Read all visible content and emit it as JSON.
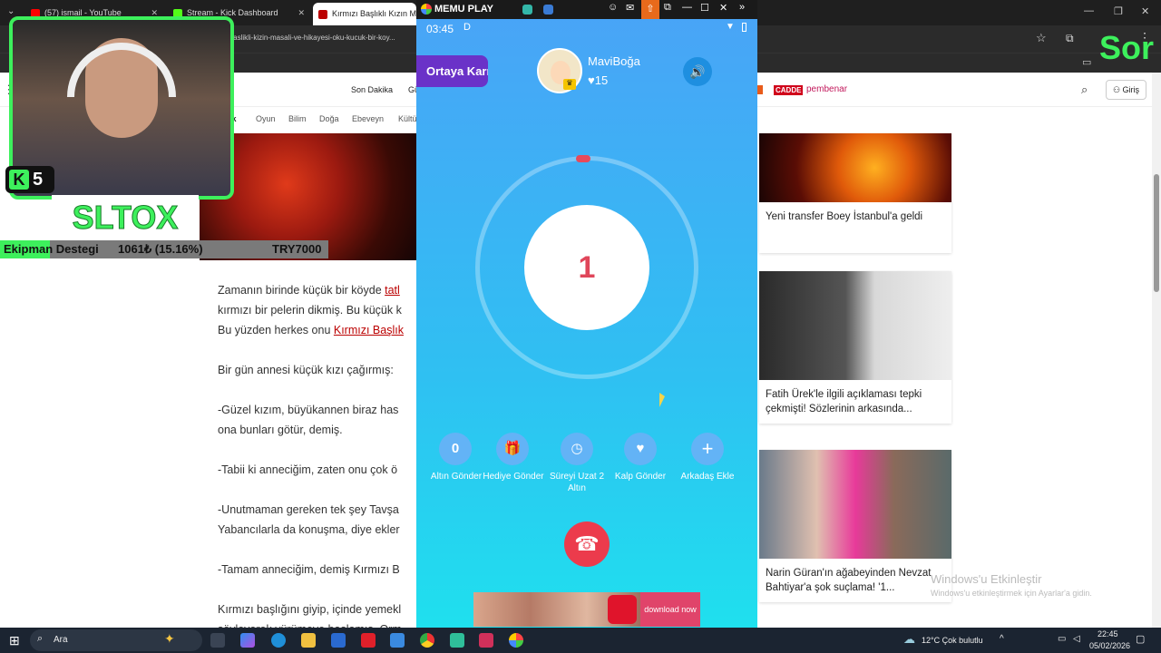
{
  "browser": {
    "tabs": [
      {
        "label": "(57) ismail - YouTube",
        "color": "#ff0000"
      },
      {
        "label": "Stream - Kick Dashboard",
        "color": "#53fc18"
      },
      {
        "label": "Kırmızı Başlıklı Kızın Masalı",
        "color": "#b00000"
      }
    ],
    "url": "-baslikli-kizin-masali-ve-hikayesi-oku-kucuk-bir-koy..."
  },
  "site": {
    "nav": [
      "Son Dakika",
      "Gü"
    ],
    "brands": [
      "CADDE",
      "pembenar"
    ],
    "login": "Giriş",
    "categories": [
      "Oyun",
      "Bilim",
      "Doğa",
      "Ebeveyn",
      "Kültü"
    ],
    "cat_prefix": "uk",
    "paragraphs": [
      {
        "pre": "Zamanın birinde küçük bir köyde ",
        "link": "tatl",
        "post": ""
      },
      {
        "pre": "kırmızı bir pelerin dikmiş. Bu küçük k",
        "link": "",
        "post": ""
      },
      {
        "pre": "Bu yüzden herkes onu ",
        "link": "Kırmızı Başlık",
        "post": ""
      },
      {
        "pre": "Bir gün annesi küçük kızı çağırmış:",
        "link": "",
        "post": ""
      },
      {
        "pre": "-Güzel kızım, büyükannen biraz has",
        "link": "",
        "post": ""
      },
      {
        "pre": "ona bunları götür, demiş.",
        "link": "",
        "post": ""
      },
      {
        "pre": "-Tabii ki anneciğim, zaten onu çok ö",
        "link": "",
        "post": ""
      },
      {
        "pre": "-Unutmaman gereken tek şey Tavşa",
        "link": "",
        "post": ""
      },
      {
        "pre": "Yabancılarla da konuşma, diye ekler",
        "link": "",
        "post": ""
      },
      {
        "pre": "-Tamam anneciğim, demiş Kırmızı B",
        "link": "",
        "post": ""
      },
      {
        "pre": "Kırmızı başlığını giyip, içinde yemekl",
        "link": "",
        "post": ""
      },
      {
        "pre": "söyleyerek yürümeye başlamış. Orm",
        "link": "",
        "post": ""
      }
    ],
    "cards": [
      {
        "title": "Yeni transfer Boey İstanbul'a geldi"
      },
      {
        "title": "Fatih Ürek'le ilgili açıklaması tepki çekmişti! Sözlerinin arkasında..."
      },
      {
        "title": "Narin Güran'ın ağabeyinden Nevzat Bahtiyar'a şok suçlama! '1..."
      }
    ],
    "watermark_title": "Windows'u Etkinleştir",
    "watermark_sub": "Windows'u etkinleştirmek için Ayarlar'a gidin."
  },
  "overlay": {
    "kick_level": "5",
    "streamer": "SLTOX",
    "donate_label": "Ekipman Destegi",
    "donate_amount": "1061₺ (15.16%)",
    "donate_goal": "TRY7000",
    "donate_progress": 0.1516,
    "corner_text": "Sor"
  },
  "memu": {
    "title": "MEMU PLAY",
    "time": "03:45",
    "ortaya_button": "Ortaya Karı",
    "username": "MaviBoğa",
    "likes": "15",
    "countdown": "1",
    "actions": [
      {
        "icon": "0",
        "label": "Altın Gönder"
      },
      {
        "icon": "gift",
        "label": "Hediye Gönder"
      },
      {
        "icon": "clock",
        "label": "Süreyi Uzat 2 Altın"
      },
      {
        "icon": "heart",
        "label": "Kalp Gönder"
      },
      {
        "icon": "plus",
        "label": "Arkadaş Ekle"
      }
    ],
    "ad_button": "download now"
  },
  "taskbar": {
    "search": "Ara",
    "weather": "12°C  Çok bulutlu",
    "time": "22:45",
    "date": "05/02/2026"
  }
}
